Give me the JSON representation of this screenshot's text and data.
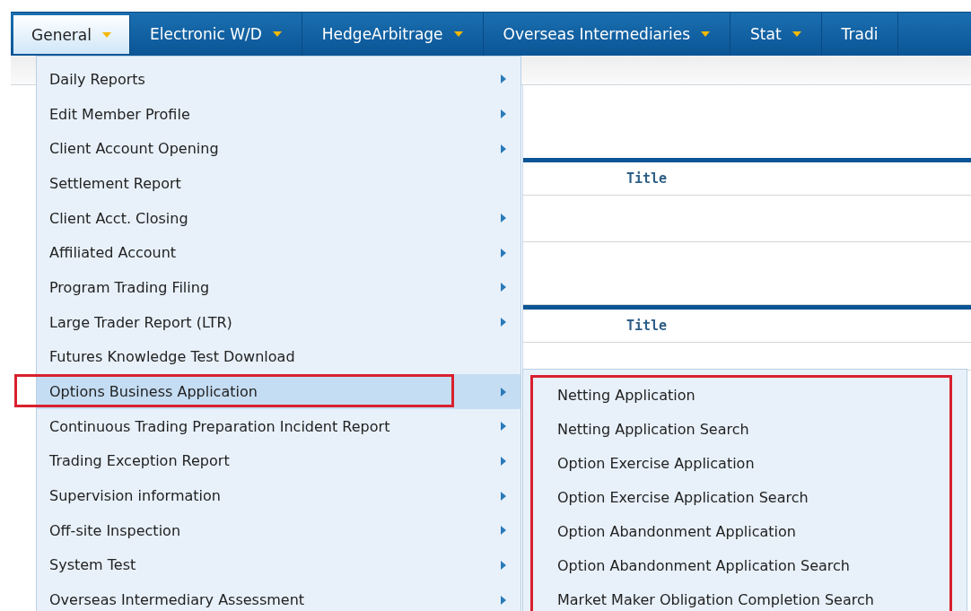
{
  "nav": [
    {
      "label": "General",
      "selected": true
    },
    {
      "label": "Electronic W/D",
      "selected": false
    },
    {
      "label": "HedgeArbitrage",
      "selected": false
    },
    {
      "label": "Overseas Intermediaries",
      "selected": false
    },
    {
      "label": "Stat",
      "selected": false
    },
    {
      "label": "Tradi",
      "selected": false
    }
  ],
  "background": {
    "titles": [
      "Title",
      "Title"
    ]
  },
  "menu": [
    {
      "label": "Daily Reports",
      "submenu": true,
      "selected": false
    },
    {
      "label": "Edit Member Profile",
      "submenu": true,
      "selected": false
    },
    {
      "label": "Client Account Opening",
      "submenu": true,
      "selected": false
    },
    {
      "label": "Settlement Report",
      "submenu": false,
      "selected": false
    },
    {
      "label": "Client Acct. Closing",
      "submenu": true,
      "selected": false
    },
    {
      "label": "Affiliated Account",
      "submenu": true,
      "selected": false
    },
    {
      "label": "Program Trading Filing",
      "submenu": true,
      "selected": false
    },
    {
      "label": "Large Trader Report (LTR)",
      "submenu": true,
      "selected": false
    },
    {
      "label": "Futures Knowledge Test Download",
      "submenu": false,
      "selected": false
    },
    {
      "label": "Options Business Application",
      "submenu": true,
      "selected": true
    },
    {
      "label": "Continuous Trading Preparation Incident Report",
      "submenu": true,
      "selected": false
    },
    {
      "label": "Trading Exception Report",
      "submenu": true,
      "selected": false
    },
    {
      "label": "Supervision information",
      "submenu": true,
      "selected": false
    },
    {
      "label": "Off-site Inspection",
      "submenu": true,
      "selected": false
    },
    {
      "label": "System Test",
      "submenu": true,
      "selected": false
    },
    {
      "label": "Overseas Intermediary Assessment",
      "submenu": true,
      "selected": false
    }
  ],
  "submenu": [
    "Netting Application",
    "Netting Application Search",
    "Option Exercise Application",
    "Option Exercise Application Search",
    "Option Abandonment Application",
    "Option Abandonment Application Search",
    "Market Maker Obligation Completion Search"
  ]
}
